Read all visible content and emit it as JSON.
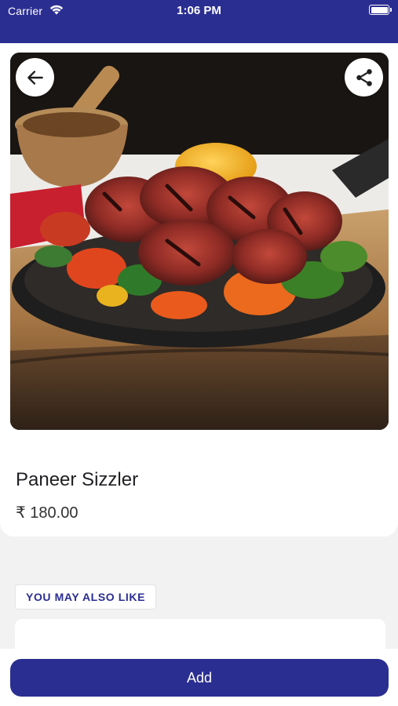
{
  "status_bar": {
    "carrier": "Carrier",
    "time": "1:06 PM"
  },
  "product": {
    "name": "Paneer Sizzler",
    "price": "₹ 180.00",
    "image_icon": "food-photo"
  },
  "navigation": {
    "back_icon": "arrow-left-icon",
    "share_icon": "share-icon"
  },
  "recommendations": {
    "heading": "YOU MAY ALSO LIKE"
  },
  "actions": {
    "add_label": "Add"
  },
  "colors": {
    "brand": "#2b2e91",
    "background": "#f2f2f3",
    "surface": "#ffffff"
  }
}
